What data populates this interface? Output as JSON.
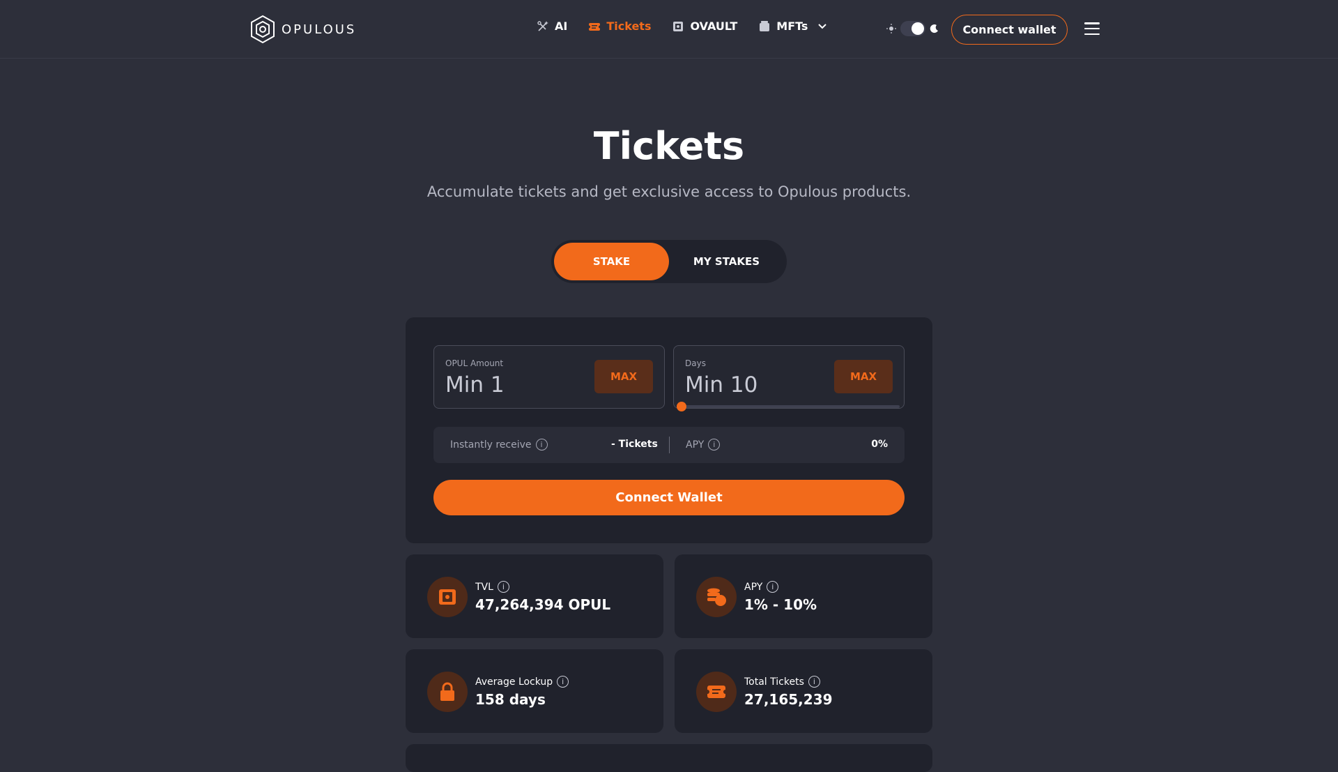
{
  "brand": {
    "name": "OPULOUS"
  },
  "nav": {
    "links": [
      {
        "label": "AI",
        "icon": "ai-sparkle-icon"
      },
      {
        "label": "Tickets",
        "icon": "ticket-icon",
        "active": true
      },
      {
        "label": "OVAULT",
        "icon": "vault-icon"
      },
      {
        "label": "MFTs",
        "icon": "wallet-icon"
      }
    ],
    "theme_mode": "dark",
    "connect_label": "Connect wallet"
  },
  "hero": {
    "title": "Tickets",
    "subtitle": "Accumulate tickets and get exclusive access to Opulous products."
  },
  "tabs": {
    "stake": "STAKE",
    "my_stakes": "MY STAKES",
    "active": "stake"
  },
  "stake_form": {
    "amount_label": "OPUL Amount",
    "amount_placeholder": "Min 1",
    "days_label": "Days",
    "days_placeholder": "Min 10",
    "max_label": "MAX",
    "instantly_receive_label": "Instantly receive",
    "instantly_receive_value": "- Tickets",
    "apy_label": "APY",
    "apy_value": "0%",
    "connect_label": "Connect Wallet"
  },
  "stats": {
    "tvl": {
      "label": "TVL",
      "value": "47,264,394 OPUL"
    },
    "apy": {
      "label": "APY",
      "value": "1% - 10%"
    },
    "lockup": {
      "label": "Average Lockup",
      "value": "158 days"
    },
    "tickets": {
      "label": "Total Tickets",
      "value": "27,165,239"
    }
  },
  "colors": {
    "accent": "#f26a1b",
    "background": "#2d2f3a",
    "card": "#20222c",
    "icon_bg": "#4f2a19"
  }
}
